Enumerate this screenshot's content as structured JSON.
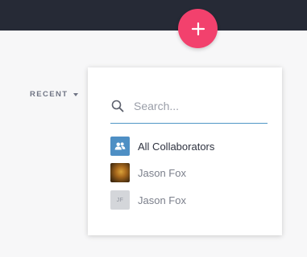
{
  "header": {
    "fab_icon": "plus-icon",
    "colors": {
      "bar": "#262a36",
      "fab": "#f2416d"
    }
  },
  "filter": {
    "label": "RECENT",
    "icon": "caret-down-icon"
  },
  "dropdown": {
    "search": {
      "icon": "search-icon",
      "placeholder": "Search...",
      "value": "",
      "accent_color": "#4f97c6"
    },
    "items": [
      {
        "label": "All Collaborators",
        "avatar": "group-icon"
      },
      {
        "label": "Jason Fox",
        "avatar": "photo"
      },
      {
        "label": "Jason Fox",
        "avatar_initials": "JF"
      }
    ]
  }
}
